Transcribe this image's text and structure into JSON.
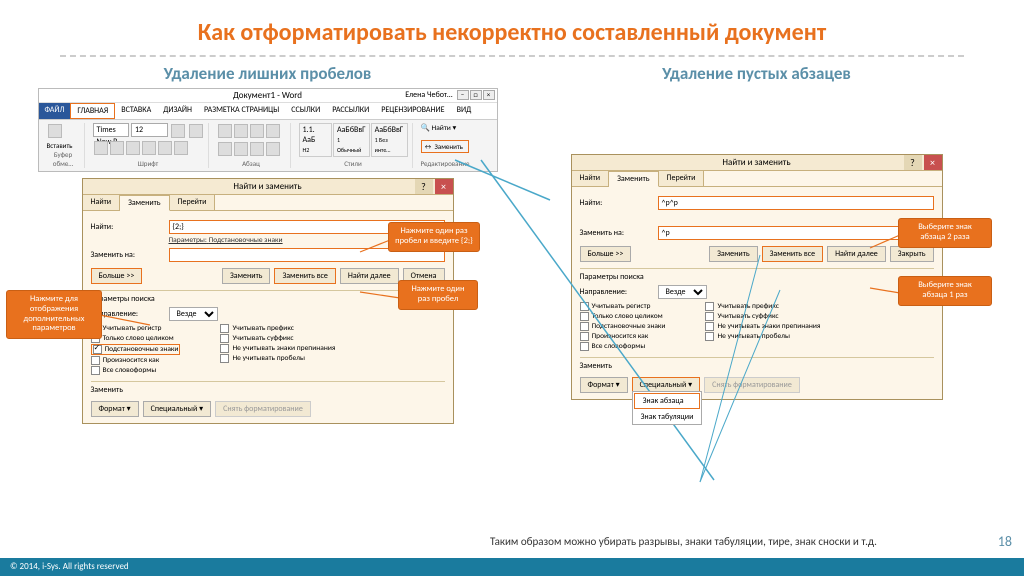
{
  "title": "Как отформатировать некорректно составленный документ",
  "left_subtitle": "Удаление лишних пробелов",
  "right_subtitle": "Удаление пустых абзацев",
  "ribbon": {
    "doc_title": "Документ1 - Word",
    "user": "Елена Чебот…",
    "tabs": {
      "file": "ФАЙЛ",
      "home": "ГЛАВНАЯ",
      "insert": "ВСТАВКА",
      "design": "ДИЗАЙН",
      "layout": "РАЗМЕТКА СТРАНИЦЫ",
      "refs": "ССЫЛКИ",
      "mail": "РАССЫЛКИ",
      "review": "РЕЦЕНЗИРОВАНИЕ",
      "view": "ВИД"
    },
    "groups": {
      "clipboard": "Буфер обме…",
      "font": "Шрифт",
      "para": "Абзац",
      "styles": "Стили",
      "editing": "Редактирование"
    },
    "font_name": "Times New R",
    "font_size": "12",
    "styles": {
      "s1": "1.1. АаБ",
      "s2": "АаБбВвГ",
      "s3": "АаБбВвГ",
      "l1": "H2",
      "l2": "1 Обычный",
      "l3": "1 Без инте…"
    },
    "find": "Найти",
    "replace": "Заменить"
  },
  "dlg": {
    "title": "Найти и заменить",
    "tabs": {
      "find": "Найти",
      "replace": "Заменить",
      "goto": "Перейти"
    },
    "find_label": "Найти:",
    "replace_label": "Заменить на:",
    "params_label": "Параметры:",
    "params_value": "Подстановочные знаки",
    "find_val_left": "{2;}",
    "replace_val_left": "",
    "find_val_right": "^p^p",
    "replace_val_right": "^p",
    "more": "Больше >>",
    "btn_replace": "Заменить",
    "btn_replace_all": "Заменить все",
    "btn_find_next": "Найти далее",
    "btn_cancel": "Отмена",
    "btn_close": "Закрыть",
    "search_section": "Параметры поиска",
    "direction": "Направление:",
    "direction_val": "Везде",
    "opt_case": "Учитывать регистр",
    "opt_whole": "Только слово целиком",
    "opt_wildcards": "Подстановочные знаки",
    "opt_sounds": "Произносится как",
    "opt_forms": "Все словоформы",
    "opt_prefix": "Учитывать префикс",
    "opt_suffix": "Учитывать суффикс",
    "opt_punct": "Не учитывать знаки препинания",
    "opt_space": "Не учитывать пробелы",
    "replace_section": "Заменить",
    "format": "Формат ▾",
    "special": "Специальный ▾",
    "noformat": "Снять форматирование",
    "sp_para": "Знак абзаца",
    "sp_tab": "Знак табуляции"
  },
  "callouts": {
    "c1": "Нажмите для отображения дополнительных параметров",
    "c2": "Нажмите один раз пробел и введите {2;}",
    "c3": "Нажмите один раз пробел",
    "c4": "Выберите знак абзаца 2 раза",
    "c5": "Выберите знак абзаца 1 раз"
  },
  "bottom_note": "Таким образом можно убирать разрывы, знаки табуляции, тире, знак сноски и т.д.",
  "footer": "© 2014, i-Sys. All rights reserved",
  "page": "18"
}
